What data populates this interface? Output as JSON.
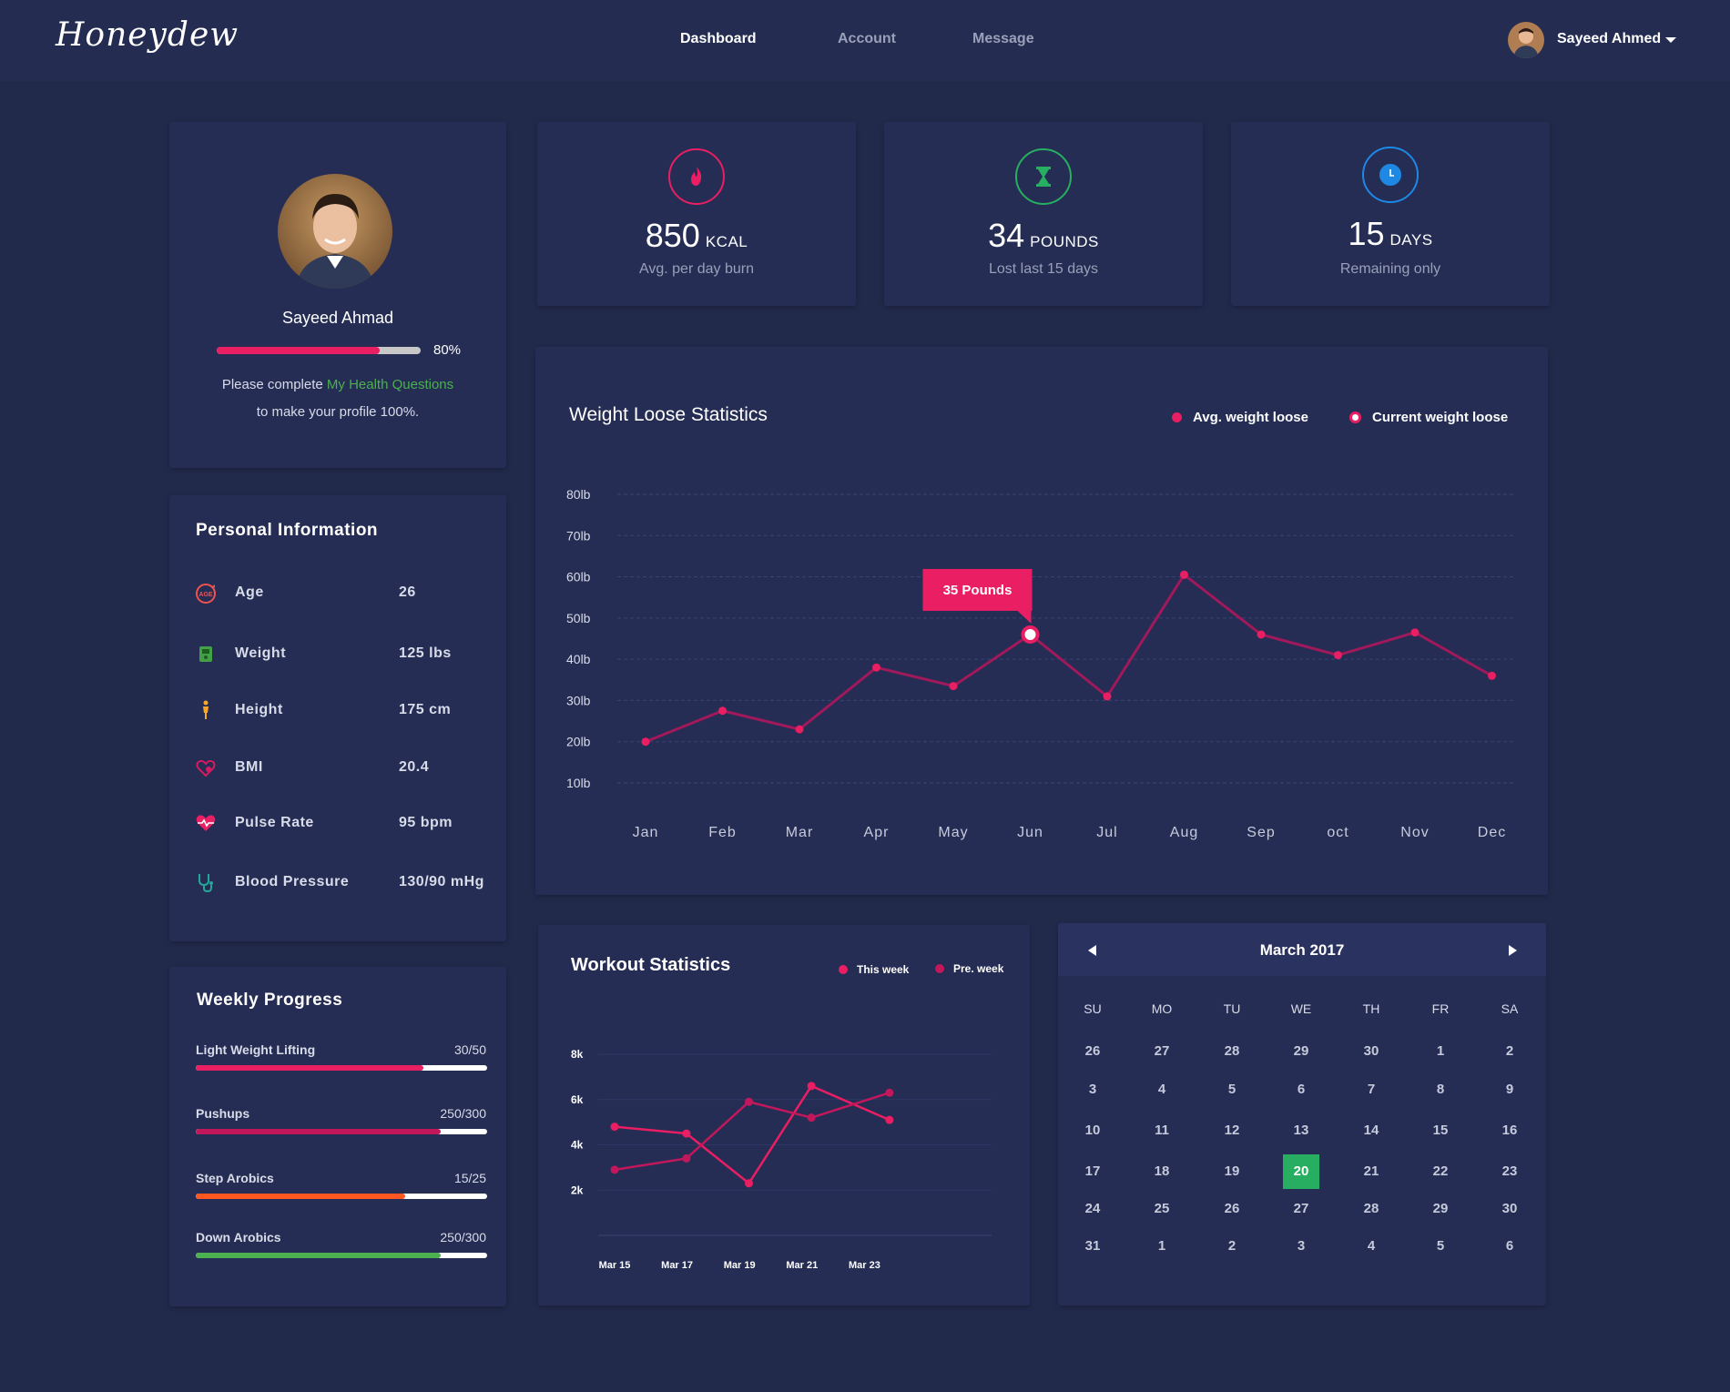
{
  "app": {
    "logo": "Honeydew"
  },
  "nav": [
    {
      "label": "Dashboard",
      "active": true
    },
    {
      "label": "Account",
      "active": false
    },
    {
      "label": "Message",
      "active": false
    }
  ],
  "user": {
    "name": "Sayeed Ahmed",
    "avatar_icon": "user-avatar"
  },
  "profile": {
    "name": "Sayeed Ahmad",
    "progress": 80,
    "progress_label": "80%",
    "complete_prefix": "Please complete",
    "complete_link": "My Health Questions",
    "complete_suffix": "to make your profile 100%."
  },
  "stats": [
    {
      "icon": "flame-icon",
      "value": "850",
      "unit": "KCAL",
      "label": "Avg. per day burn",
      "color": "#e91e63"
    },
    {
      "icon": "hourglass-icon",
      "value": "34",
      "unit": "POUNDS",
      "label": "Lost last 15 days",
      "color": "#27ae60"
    },
    {
      "icon": "clock-icon",
      "value": "15",
      "unit": "DAYS",
      "label": "Remaining only",
      "color": "#1e88e5"
    }
  ],
  "personal": {
    "title": "Personal Information",
    "rows": [
      {
        "icon": "age-icon",
        "label": "Age",
        "value": "26"
      },
      {
        "icon": "scale-icon",
        "label": "Weight",
        "value": "125 lbs"
      },
      {
        "icon": "person-height-icon",
        "label": "Height",
        "value": "175 cm"
      },
      {
        "icon": "bmi-heart-icon",
        "label": "BMI",
        "value": "20.4"
      },
      {
        "icon": "pulse-heart-icon",
        "label": "Pulse Rate",
        "value": "95 bpm"
      },
      {
        "icon": "stethoscope-icon",
        "label": "Blood Pressure",
        "value": "130/90 mHg"
      }
    ]
  },
  "weekly": {
    "title": "Weekly Progress",
    "items": [
      {
        "label": "Light Weight Lifting",
        "value": "30/50",
        "fraction": 0.78,
        "color": "#e91e63"
      },
      {
        "label": "Pushups",
        "value": "250/300",
        "fraction": 0.84,
        "color": "#c2185b"
      },
      {
        "label": "Step Arobics",
        "value": "15/25",
        "fraction": 0.72,
        "color": "#ff5722"
      },
      {
        "label": "Down Arobics",
        "value": "250/300",
        "fraction": 0.84,
        "color": "#4caf50"
      }
    ]
  },
  "chart_data": [
    {
      "type": "line",
      "title": "Weight Loose Statistics",
      "categories": [
        "Jan",
        "Feb",
        "Mar",
        "Apr",
        "May",
        "Jun",
        "Jul",
        "Aug",
        "Sep",
        "oct",
        "Nov",
        "Dec"
      ],
      "ytick_labels": [
        "80lb",
        "70lb",
        "60lb",
        "50lb",
        "40lb",
        "30lb",
        "20lb",
        "10lb"
      ],
      "yticks": [
        80,
        70,
        60,
        50,
        40,
        30,
        20,
        10
      ],
      "ylim": [
        10,
        80
      ],
      "series": [
        {
          "values": [
            20,
            27.5,
            23,
            38,
            33.5,
            46,
            31,
            60.5,
            46,
            41,
            46.5,
            36
          ],
          "color": "#a0195a"
        }
      ],
      "legend": [
        {
          "name": "Avg. weight loose",
          "color": "#e91e63"
        },
        {
          "name": "Current weight loose",
          "color": "#e91e63"
        }
      ],
      "annotation": {
        "label": "35 Pounds",
        "category": "Jun",
        "color": "#e91e63"
      },
      "grid": true,
      "legend_position": "top-right"
    },
    {
      "type": "line",
      "title": "Workout Statistics",
      "categories": [
        "Mar 15",
        "Mar 17",
        "Mar 19",
        "Mar 21",
        "Mar 23"
      ],
      "x": [
        15,
        16,
        17,
        18,
        19,
        20,
        21,
        22,
        23
      ],
      "ytick_labels": [
        "8k",
        "6k",
        "4k",
        "2k"
      ],
      "yticks": [
        8000,
        6000,
        4000,
        2000
      ],
      "ylim": [
        0,
        8000
      ],
      "series": [
        {
          "name": "This week",
          "color": "#e91e63",
          "x": [
            15,
            17.3,
            19.3,
            21.3,
            23.8
          ],
          "values": [
            4800,
            4500,
            2300,
            6600,
            5100
          ]
        },
        {
          "name": "Pre. week",
          "color": "#c2185b",
          "x": [
            15,
            17.3,
            19.3,
            21.3,
            23.8
          ],
          "values": [
            2900,
            3400,
            5900,
            5200,
            6300
          ]
        }
      ],
      "grid": true,
      "legend_position": "top-right"
    }
  ],
  "calendar": {
    "title": "March 2017",
    "days_of_week": [
      "SU",
      "MO",
      "TU",
      "WE",
      "TH",
      "FR",
      "SA"
    ],
    "weeks": [
      [
        "26",
        "27",
        "28",
        "29",
        "30",
        "1",
        "2"
      ],
      [
        "3",
        "4",
        "5",
        "6",
        "7",
        "8",
        "9"
      ],
      [
        "10",
        "11",
        "12",
        "13",
        "14",
        "15",
        "16"
      ],
      [
        "17",
        "18",
        "19",
        "20",
        "21",
        "22",
        "23"
      ],
      [
        "24",
        "25",
        "26",
        "27",
        "28",
        "29",
        "30"
      ],
      [
        "31",
        "1",
        "2",
        "3",
        "4",
        "5",
        "6"
      ]
    ],
    "today": "20",
    "today_color": "#27ae60"
  }
}
